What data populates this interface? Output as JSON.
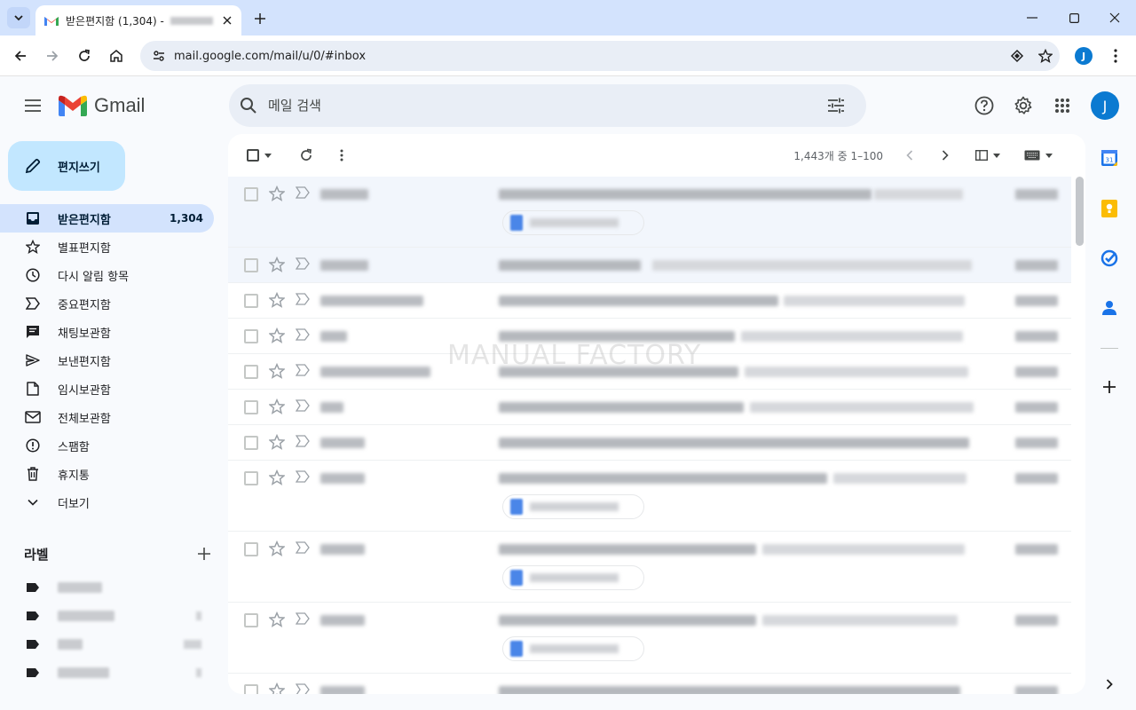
{
  "browser": {
    "tab_title": "받은편지함 (1,304) -",
    "url": "mail.google.com/mail/u/0/#inbox",
    "profile_initial": "J"
  },
  "app": {
    "name": "Gmail",
    "search_placeholder": "메일 검색",
    "avatar_initial": "J"
  },
  "compose": {
    "label": "편지쓰기"
  },
  "nav": [
    {
      "label": "받은편지함",
      "count": "1,304",
      "icon": "inbox-icon",
      "active": true
    },
    {
      "label": "별표편지함",
      "count": "",
      "icon": "star-icon"
    },
    {
      "label": "다시 알림 항목",
      "count": "",
      "icon": "clock-icon"
    },
    {
      "label": "중요편지함",
      "count": "",
      "icon": "important-icon"
    },
    {
      "label": "채팅보관함",
      "count": "",
      "icon": "chat-icon"
    },
    {
      "label": "보낸편지함",
      "count": "",
      "icon": "send-icon"
    },
    {
      "label": "임시보관함",
      "count": "",
      "icon": "draft-icon"
    },
    {
      "label": "전체보관함",
      "count": "",
      "icon": "all-mail-icon"
    },
    {
      "label": "스팸함",
      "count": "",
      "icon": "spam-icon"
    },
    {
      "label": "휴지통",
      "count": "",
      "icon": "trash-icon"
    },
    {
      "label": "더보기",
      "count": "",
      "icon": "chevron-down-icon"
    }
  ],
  "labels": {
    "title": "라벨"
  },
  "list": {
    "pager": "1,443개 중 1–100"
  },
  "watermark": "MANUAL FACTORY",
  "colors": {
    "accent": "#0b57d0",
    "compose_bg": "#c2e7ff",
    "active_nav_bg": "#d3e3fd",
    "avatar_bg": "#0b7ad1"
  }
}
